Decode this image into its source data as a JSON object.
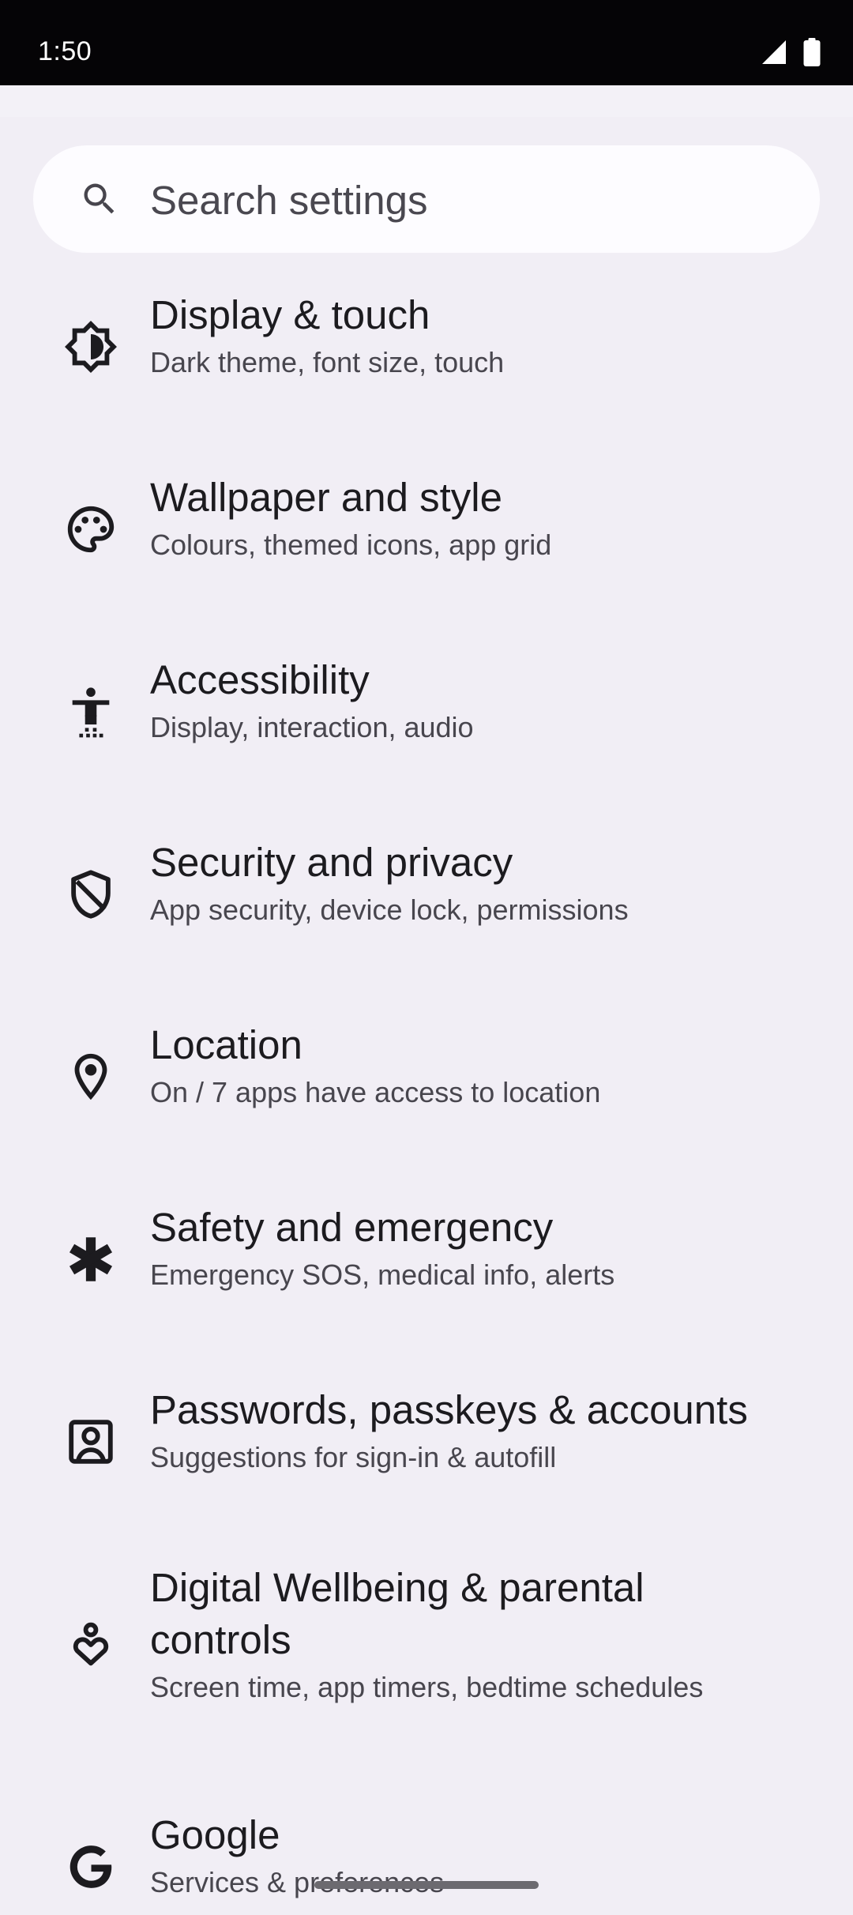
{
  "status_bar": {
    "time": "1:50",
    "icons": [
      "signal-icon",
      "battery-icon"
    ]
  },
  "search": {
    "placeholder": "Search settings",
    "icon": "search-icon"
  },
  "items": [
    {
      "title": "Display & touch",
      "subtitle": "Dark theme, font size, touch",
      "icon": "display-brightness-icon"
    },
    {
      "title": "Wallpaper and style",
      "subtitle": "Colours, themed icons, app grid",
      "icon": "palette-icon"
    },
    {
      "title": "Accessibility",
      "subtitle": "Display, interaction, audio",
      "icon": "accessibility-icon"
    },
    {
      "title": "Security and privacy",
      "subtitle": "App security, device lock, permissions",
      "icon": "shield-icon"
    },
    {
      "title": "Location",
      "subtitle": "On / 7 apps have access to location",
      "icon": "location-pin-icon"
    },
    {
      "title": "Safety and emergency",
      "subtitle": "Emergency SOS, medical info, alerts",
      "icon": "asterisk-icon"
    },
    {
      "title": "Passwords, passkeys & accounts",
      "subtitle": "Suggestions for sign-in & autofill",
      "icon": "account-box-icon"
    },
    {
      "title": "Digital Wellbeing & parental controls",
      "subtitle": "Screen time, app timers, bedtime schedules",
      "icon": "wellbeing-icon"
    },
    {
      "title": "Google",
      "subtitle": "Services & preferences",
      "icon": "google-icon"
    }
  ]
}
